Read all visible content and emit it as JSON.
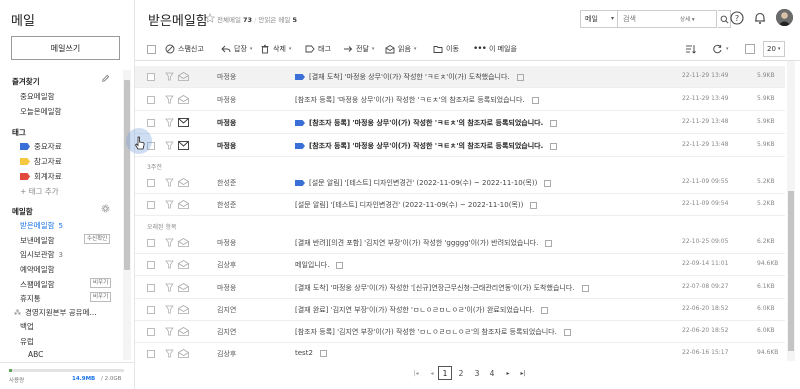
{
  "app": {
    "title": "메일",
    "compose_label": "메일쓰기"
  },
  "sidebar": {
    "favorites_title": "즐겨찾기",
    "favorites": [
      {
        "label": "중요메일함"
      },
      {
        "label": "오늘온메일함"
      }
    ],
    "tags_title": "태그",
    "tags": [
      {
        "label": "중요자료",
        "color": "#3b6fd8"
      },
      {
        "label": "참고자료",
        "color": "#f5c842"
      },
      {
        "label": "회계자료",
        "color": "#e04a3c"
      }
    ],
    "add_tag_label": "+ 태그 추가",
    "mailbox_title": "메일함",
    "mailboxes": [
      {
        "label": "받은메일함",
        "count": "5",
        "active": true
      },
      {
        "label": "보낸메일함",
        "badge": "수신확인"
      },
      {
        "label": "임시보관함",
        "count": "3"
      },
      {
        "label": "예약메일함"
      },
      {
        "label": "스팸메일함",
        "badge": "비우기"
      },
      {
        "label": "휴지통",
        "badge": "비우기"
      },
      {
        "label": "경영지원본부 공유메..."
      },
      {
        "label": "백업"
      },
      {
        "label": "유럽"
      },
      {
        "label": "ABC"
      }
    ],
    "storage": {
      "label": "사용량",
      "used": "14.9MB",
      "total": "/ 2.0GB",
      "fraction": 0.01
    }
  },
  "header": {
    "title": "받은메일함",
    "total_label": "전체메일",
    "total_count": "73",
    "unread_label": "안읽은 메일",
    "unread_count": "5",
    "search_scope": "메일",
    "search_placeholder": "검색",
    "search_detail": "상세 ▾"
  },
  "toolbar": {
    "spam_report": "스팸신고",
    "reply": "답장",
    "delete": "삭제",
    "tag": "태그",
    "forward": "전달",
    "read": "읽음",
    "move": "이동",
    "more": "이 메일을",
    "page_size": "20"
  },
  "groups": {
    "three_weeks": "3주전",
    "older": "오래된 항목"
  },
  "emails": [
    {
      "sender": "마정웅",
      "subject": "[결재 도착] '마정웅 상무'이(가) 작성한 'ㅋㅌㅊ'이(가) 도착했습니다.",
      "date": "22-11-29 13:49",
      "size": "5.9KB",
      "tag": true,
      "unread": false,
      "highlight": true,
      "env": false
    },
    {
      "sender": "마정웅",
      "subject": "[참조자 등록] '마정웅 상무'이(가) 작성한 'ㅋㅌㅊ'의 참조자로 등록되었습니다.",
      "date": "22-11-29 13:49",
      "size": "5.9KB",
      "tag": false,
      "unread": false,
      "env": false
    },
    {
      "sender": "마정웅",
      "subject": "[참조자 등록] '마정웅 상무'이(가) 작성한 'ㅋㅌㅊ'의 참조자로 등록되었습니다.",
      "date": "22-11-29 13:48",
      "size": "5.9KB",
      "tag": true,
      "unread": true,
      "env": true
    },
    {
      "sender": "마정웅",
      "subject": "[참조자 등록] '마정웅 상무'이(가) 작성한 'ㅋㅌㅊ'의 참조자로 등록되었습니다.",
      "date": "22-11-29 13:48",
      "size": "5.9KB",
      "tag": true,
      "unread": true,
      "env": true
    },
    {
      "sender": "한성준",
      "subject": "[설문 알림] '[테스트] 디자인변경건' (2022-11-09(수) ~ 2022-11-10(목))",
      "date": "22-11-09 09:55",
      "size": "5.2KB",
      "tag": true,
      "unread": false,
      "env": false
    },
    {
      "sender": "한성준",
      "subject": "[설문 알림] '[테스트] 디자인변경건' (2022-11-09(수) ~ 2022-11-10(목))",
      "date": "22-11-09 09:54",
      "size": "5.2KB",
      "tag": false,
      "unread": false,
      "env": false
    },
    {
      "sender": "마정웅",
      "subject": "[결재 반려][의견 포함] '김지연 부장'이(가) 작성한 'ggggg'이(가) 반려되었습니다.",
      "date": "22-10-25 09:05",
      "size": "6.2KB",
      "tag": false,
      "unread": false,
      "env": false
    },
    {
      "sender": "김상후",
      "subject": "메일입니다.",
      "date": "22-09-14 11:01",
      "size": "94.6KB",
      "tag": false,
      "unread": false,
      "env": false
    },
    {
      "sender": "마정웅",
      "subject": "[결재 도착] '마정웅 상무'이(가) 작성한 '[신규]연장근무신청-근태관리연동'이(가) 도착했습니다.",
      "date": "22-07-08 09:27",
      "size": "6.1KB",
      "tag": false,
      "unread": false,
      "env": false
    },
    {
      "sender": "김지연",
      "subject": "[결재 완료] '김지연 부장'이(가) 작성한 'ㅁㄴㅇㄹㅁㄴㅇㄹ'이(가) 완료되었습니다.",
      "date": "22-06-20 18:52",
      "size": "6.0KB",
      "tag": false,
      "unread": false,
      "env": false
    },
    {
      "sender": "김지연",
      "subject": "[참조자 등록] '김지연 부장'이(가) 작성한 'ㅁㄴㅇㄹㅁㄴㅇㄹ'의 참조자로 등록되었습니다.",
      "date": "22-06-20 18:52",
      "size": "6.0KB",
      "tag": false,
      "unread": false,
      "env": false
    },
    {
      "sender": "김상후",
      "subject": "test2",
      "date": "22-06-16 15:17",
      "size": "94.6KB",
      "tag": false,
      "unread": false,
      "env": false
    }
  ],
  "pager": {
    "pages": [
      "1",
      "2",
      "3",
      "4"
    ],
    "current": "1"
  }
}
